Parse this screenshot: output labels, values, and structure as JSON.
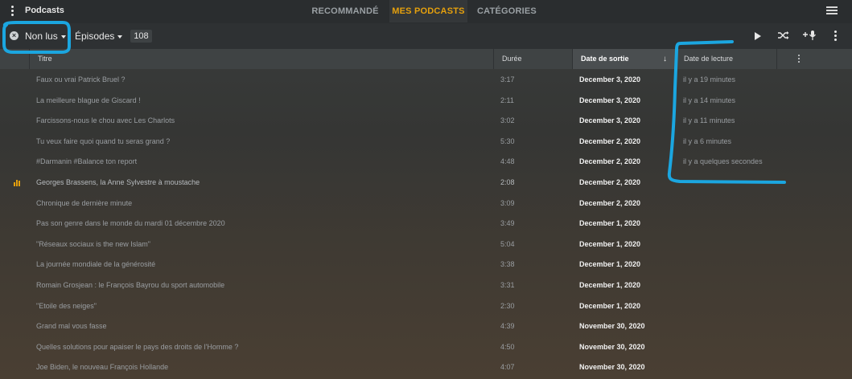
{
  "app": {
    "title": "Podcasts"
  },
  "tabs": [
    {
      "label": "RECOMMANDÉ",
      "active": false
    },
    {
      "label": "MES PODCASTS",
      "active": true
    },
    {
      "label": "CATÉGORIES",
      "active": false
    }
  ],
  "filter": {
    "label": "Non lus",
    "episodes_label": "Épisodes",
    "count": "108"
  },
  "table": {
    "columns": [
      {
        "label": "Titre"
      },
      {
        "label": "Durée"
      },
      {
        "label": "Date de sortie",
        "sorted": true
      },
      {
        "label": "Date de lecture"
      }
    ],
    "rows": [
      {
        "title": "Faux ou vrai Patrick Bruel ?",
        "duration": "3:17",
        "release": "December 3, 2020",
        "read": "il y a 19 minutes"
      },
      {
        "title": "La meilleure blague de Giscard !",
        "duration": "2:11",
        "release": "December 3, 2020",
        "read": "il y a 14 minutes"
      },
      {
        "title": "Farcissons-nous le chou avec Les Charlots",
        "duration": "3:02",
        "release": "December 3, 2020",
        "read": "il y a 11 minutes"
      },
      {
        "title": "Tu veux faire quoi quand tu seras grand ?",
        "duration": "5:30",
        "release": "December 2, 2020",
        "read": "il y a 6 minutes"
      },
      {
        "title": "#Darmanin #Balance ton report",
        "duration": "4:48",
        "release": "December 2, 2020",
        "read": "il y a quelques secondes"
      },
      {
        "title": "Georges Brassens, la Anne Sylvestre à moustache",
        "duration": "2:08",
        "release": "December 2, 2020",
        "read": "",
        "playing": true
      },
      {
        "title": "Chronique de dernière minute",
        "duration": "3:09",
        "release": "December 2, 2020",
        "read": ""
      },
      {
        "title": "Pas son genre dans le monde du mardi 01 décembre 2020",
        "duration": "3:49",
        "release": "December 1, 2020",
        "read": ""
      },
      {
        "title": "\"Réseaux sociaux is the new Islam\"",
        "duration": "5:04",
        "release": "December 1, 2020",
        "read": ""
      },
      {
        "title": "La journée mondiale de la générosité",
        "duration": "3:38",
        "release": "December 1, 2020",
        "read": ""
      },
      {
        "title": "Romain Grosjean : le François Bayrou du sport automobile",
        "duration": "3:31",
        "release": "December 1, 2020",
        "read": ""
      },
      {
        "title": "\"Etoile des neiges\"",
        "duration": "2:30",
        "release": "December 1, 2020",
        "read": ""
      },
      {
        "title": "Grand mal vous fasse",
        "duration": "4:39",
        "release": "November 30, 2020",
        "read": ""
      },
      {
        "title": "Quelles solutions pour apaiser le pays des droits de l'Homme ?",
        "duration": "4:50",
        "release": "November 30, 2020",
        "read": ""
      },
      {
        "title": "Joe Biden, le nouveau François Hollande",
        "duration": "4:07",
        "release": "November 30, 2020",
        "read": ""
      }
    ]
  },
  "colors": {
    "accent": "#e5a00d",
    "annotation": "#1ba6e0"
  }
}
